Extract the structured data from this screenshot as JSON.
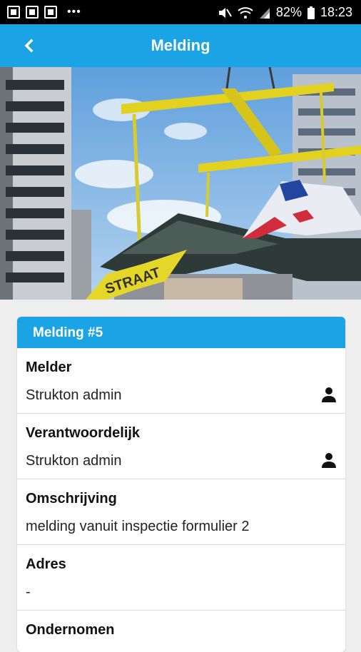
{
  "statusbar": {
    "dots": "•••",
    "battery": "82%",
    "time": "18:23"
  },
  "appbar": {
    "title": "Melding"
  },
  "hero": {
    "sign_text": "STRAAT"
  },
  "card": {
    "title": "Melding #5",
    "rows": [
      {
        "label": "Melder",
        "value": "Strukton admin",
        "icon": "person-icon"
      },
      {
        "label": "Verantwoordelijk",
        "value": "Strukton admin",
        "icon": "person-icon"
      },
      {
        "label": "Omschrijving",
        "value": "melding vanuit inspectie formulier 2"
      },
      {
        "label": "Adres",
        "value": "-"
      },
      {
        "label": "Ondernomen",
        "value": ""
      }
    ]
  },
  "colors": {
    "accent": "#1aa3e5",
    "statusbar": "#000000",
    "background": "#eeeeee"
  }
}
